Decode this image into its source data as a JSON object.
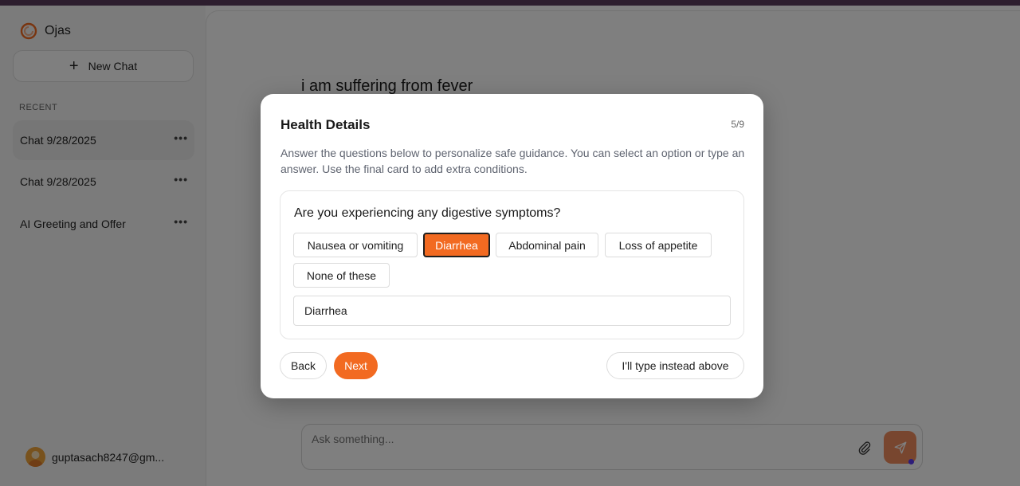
{
  "app": {
    "name": "Ojas",
    "brand_color": "#f26a21"
  },
  "sidebar": {
    "new_chat_label": "New Chat",
    "recent_label": "RECENT",
    "items": [
      {
        "label": "Chat 9/28/2025",
        "active": true
      },
      {
        "label": "Chat 9/28/2025",
        "active": false
      },
      {
        "label": "AI Greeting and Offer",
        "active": false
      }
    ],
    "more_glyph": "•••",
    "user_email": "guptasach8247@gm..."
  },
  "conversation": {
    "user_message": "i am suffering from fever"
  },
  "composer": {
    "placeholder": "Ask something..."
  },
  "modal": {
    "title": "Health Details",
    "step": "5/9",
    "description": "Answer the questions below to personalize safe guidance. You can select an option or type an answer. Use the final card to add extra conditions.",
    "question": "Are you experiencing any digestive symptoms?",
    "options": [
      {
        "label": "Nausea or vomiting",
        "selected": false
      },
      {
        "label": "Diarrhea",
        "selected": true
      },
      {
        "label": "Abdominal pain",
        "selected": false
      },
      {
        "label": "Loss of appetite",
        "selected": false
      },
      {
        "label": "None of these",
        "selected": false
      }
    ],
    "answer_value": "Diarrhea",
    "back_label": "Back",
    "next_label": "Next",
    "type_instead_label": "I'll type instead above"
  }
}
